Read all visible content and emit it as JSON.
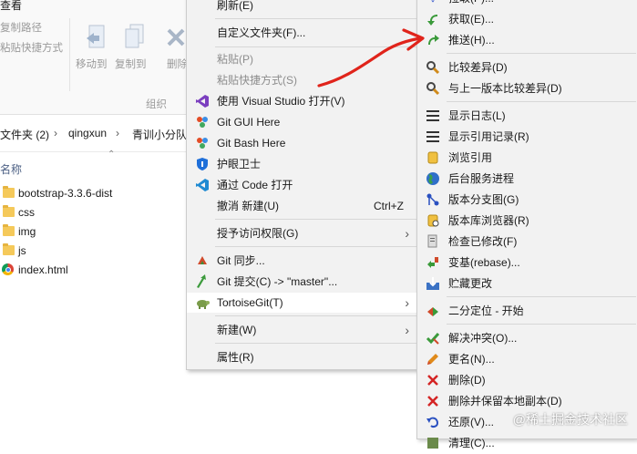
{
  "ribbon": {
    "tab": "查看",
    "copy_path": "复制路径",
    "paste_shortcut": "粘贴快捷方式",
    "move_to": "移动到",
    "copy_to": "复制到",
    "delete": "删除",
    "group": "组织"
  },
  "address": {
    "crumbs": [
      "文件夹 (2)",
      "qingxun",
      "青训小分队"
    ]
  },
  "file_list": {
    "column": "名称",
    "items": [
      {
        "name": "bootstrap-3.3.6-dist",
        "type": "folder"
      },
      {
        "name": "css",
        "type": "folder"
      },
      {
        "name": "img",
        "type": "folder"
      },
      {
        "name": "js",
        "type": "folder"
      },
      {
        "name": "index.html",
        "type": "html"
      }
    ]
  },
  "context_menu": {
    "refresh": "刷新(E)",
    "custom_folder": "自定义文件夹(F)...",
    "paste": "粘贴(P)",
    "paste_shortcut": "粘贴快捷方式(S)",
    "open_vs": "使用 Visual Studio 打开(V)",
    "git_gui": "Git GUI Here",
    "git_bash": "Git Bash Here",
    "eye_guard": "护眼卫士",
    "open_code": "通过 Code 打开",
    "undo_new": "撤消 新建(U)",
    "undo_shortcut": "Ctrl+Z",
    "grant_access": "授予访问权限(G)",
    "git_sync": "Git 同步...",
    "git_commit": "Git 提交(C) -> \"master\"...",
    "tortoise": "TortoiseGit(T)",
    "new": "新建(W)",
    "properties": "属性(R)"
  },
  "submenu": {
    "pull_partial": "拉取(P)...",
    "fetch": "获取(E)...",
    "push": "推送(H)...",
    "diff": "比较差异(D)",
    "diff_prev": "与上一版本比较差异(D)",
    "show_log": "显示日志(L)",
    "show_reflog": "显示引用记录(R)",
    "browse_refs": "浏览引用",
    "daemon": "后台服务进程",
    "revision_graph": "版本分支图(G)",
    "repo_browser": "版本库浏览器(R)",
    "check_mods": "检查已修改(F)",
    "rebase": "变基(rebase)...",
    "stash": "贮藏更改",
    "bisect": "二分定位 - 开始",
    "resolve": "解决冲突(O)...",
    "rename": "更名(N)...",
    "delete": "删除(D)",
    "delete_keep": "删除并保留本地副本(D)",
    "revert": "还原(V)...",
    "cleanup_partial": "清理(C)..."
  },
  "watermark": "@稀土掘金技术社区",
  "colors": {
    "annotation_arrow": "#e0241b",
    "menu_bg": "#f2f2f2",
    "folder": "#f5c95a"
  }
}
